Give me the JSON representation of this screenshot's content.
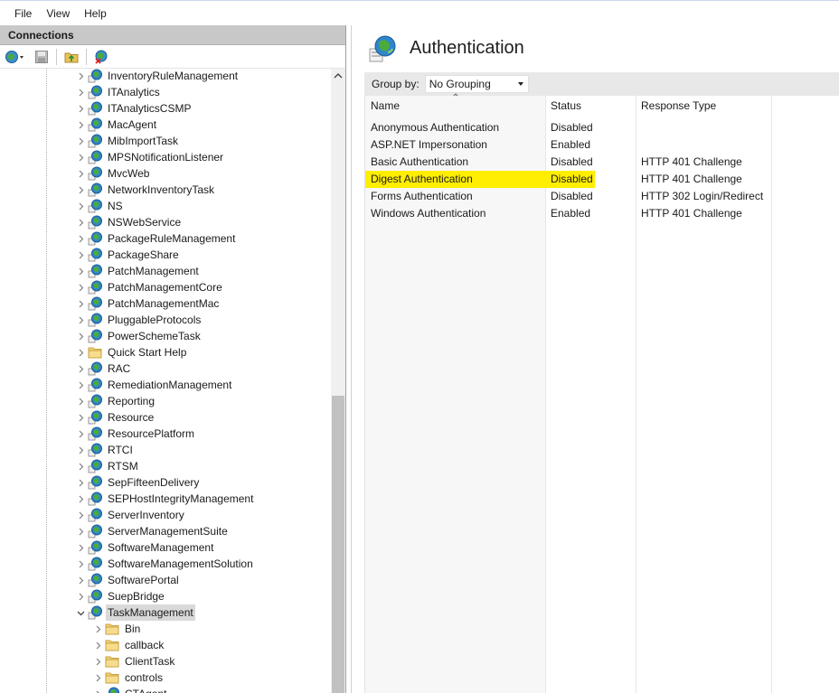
{
  "menu": [
    "File",
    "View",
    "Help"
  ],
  "connections": {
    "title": "Connections",
    "tree_items": [
      {
        "label": "InventoryRuleManagement",
        "icon": "web-app-icon",
        "state": "collapsed"
      },
      {
        "label": "ITAnalytics",
        "icon": "web-app-icon",
        "state": "collapsed"
      },
      {
        "label": "ITAnalyticsCSMP",
        "icon": "web-app-icon",
        "state": "collapsed"
      },
      {
        "label": "MacAgent",
        "icon": "web-app-icon",
        "state": "collapsed"
      },
      {
        "label": "MibImportTask",
        "icon": "web-app-icon",
        "state": "collapsed"
      },
      {
        "label": "MPSNotificationListener",
        "icon": "web-app-icon",
        "state": "collapsed"
      },
      {
        "label": "MvcWeb",
        "icon": "web-app-icon",
        "state": "collapsed"
      },
      {
        "label": "NetworkInventoryTask",
        "icon": "web-app-icon",
        "state": "collapsed"
      },
      {
        "label": "NS",
        "icon": "web-app-icon",
        "state": "collapsed"
      },
      {
        "label": "NSWebService",
        "icon": "web-app-icon",
        "state": "collapsed"
      },
      {
        "label": "PackageRuleManagement",
        "icon": "web-app-icon",
        "state": "collapsed"
      },
      {
        "label": "PackageShare",
        "icon": "web-app-icon",
        "state": "collapsed"
      },
      {
        "label": "PatchManagement",
        "icon": "web-app-icon",
        "state": "collapsed"
      },
      {
        "label": "PatchManagementCore",
        "icon": "web-app-icon",
        "state": "collapsed"
      },
      {
        "label": "PatchManagementMac",
        "icon": "web-app-icon",
        "state": "collapsed"
      },
      {
        "label": "PluggableProtocols",
        "icon": "web-app-icon",
        "state": "collapsed"
      },
      {
        "label": "PowerSchemeTask",
        "icon": "web-app-icon",
        "state": "collapsed"
      },
      {
        "label": "Quick Start Help",
        "icon": "folder-icon",
        "state": "collapsed"
      },
      {
        "label": "RAC",
        "icon": "web-app-icon",
        "state": "collapsed"
      },
      {
        "label": "RemediationManagement",
        "icon": "web-app-icon",
        "state": "collapsed"
      },
      {
        "label": "Reporting",
        "icon": "web-app-icon",
        "state": "collapsed"
      },
      {
        "label": "Resource",
        "icon": "web-app-icon",
        "state": "collapsed"
      },
      {
        "label": "ResourcePlatform",
        "icon": "web-app-icon",
        "state": "collapsed"
      },
      {
        "label": "RTCI",
        "icon": "web-app-icon",
        "state": "collapsed"
      },
      {
        "label": "RTSM",
        "icon": "web-app-icon",
        "state": "collapsed"
      },
      {
        "label": "SepFifteenDelivery",
        "icon": "web-app-icon",
        "state": "collapsed"
      },
      {
        "label": "SEPHostIntegrityManagement",
        "icon": "web-app-icon",
        "state": "collapsed"
      },
      {
        "label": "ServerInventory",
        "icon": "web-app-icon",
        "state": "collapsed"
      },
      {
        "label": "ServerManagementSuite",
        "icon": "web-app-icon",
        "state": "collapsed"
      },
      {
        "label": "SoftwareManagement",
        "icon": "web-app-icon",
        "state": "collapsed"
      },
      {
        "label": "SoftwareManagementSolution",
        "icon": "web-app-icon",
        "state": "collapsed"
      },
      {
        "label": "SoftwarePortal",
        "icon": "web-app-icon",
        "state": "collapsed"
      },
      {
        "label": "SuepBridge",
        "icon": "web-app-icon",
        "state": "collapsed"
      },
      {
        "label": "TaskManagement",
        "icon": "web-app-icon",
        "state": "expanded",
        "selected": true
      },
      {
        "label": "Bin",
        "icon": "folder-icon",
        "state": "collapsed",
        "child": true
      },
      {
        "label": "callback",
        "icon": "folder-icon",
        "state": "collapsed",
        "child": true
      },
      {
        "label": "ClientTask",
        "icon": "folder-icon",
        "state": "collapsed",
        "child": true
      },
      {
        "label": "controls",
        "icon": "folder-icon",
        "state": "collapsed",
        "child": true
      },
      {
        "label": "CTAgent",
        "icon": "web-app-icon",
        "state": "collapsed",
        "child": true
      }
    ]
  },
  "feature": {
    "title": "Authentication",
    "group_by_label": "Group by:",
    "group_by_value": "No Grouping",
    "columns": [
      "Name",
      "Status",
      "Response Type"
    ],
    "rows": [
      {
        "name": "Anonymous Authentication",
        "status": "Disabled",
        "response": ""
      },
      {
        "name": "ASP.NET Impersonation",
        "status": "Enabled",
        "response": ""
      },
      {
        "name": "Basic Authentication",
        "status": "Disabled",
        "response": "HTTP 401 Challenge"
      },
      {
        "name": "Digest Authentication",
        "status": "Disabled",
        "response": "HTTP 401 Challenge",
        "highlighted": true
      },
      {
        "name": "Forms Authentication",
        "status": "Disabled",
        "response": "HTTP 302 Login/Redirect"
      },
      {
        "name": "Windows Authentication",
        "status": "Enabled",
        "response": "HTTP 401 Challenge"
      }
    ]
  },
  "colors": {
    "highlight": "#ffee00",
    "panel_header": "#c8c8c8",
    "selected_item": "#d9d9d9",
    "name_column": "#f7f7f7"
  }
}
